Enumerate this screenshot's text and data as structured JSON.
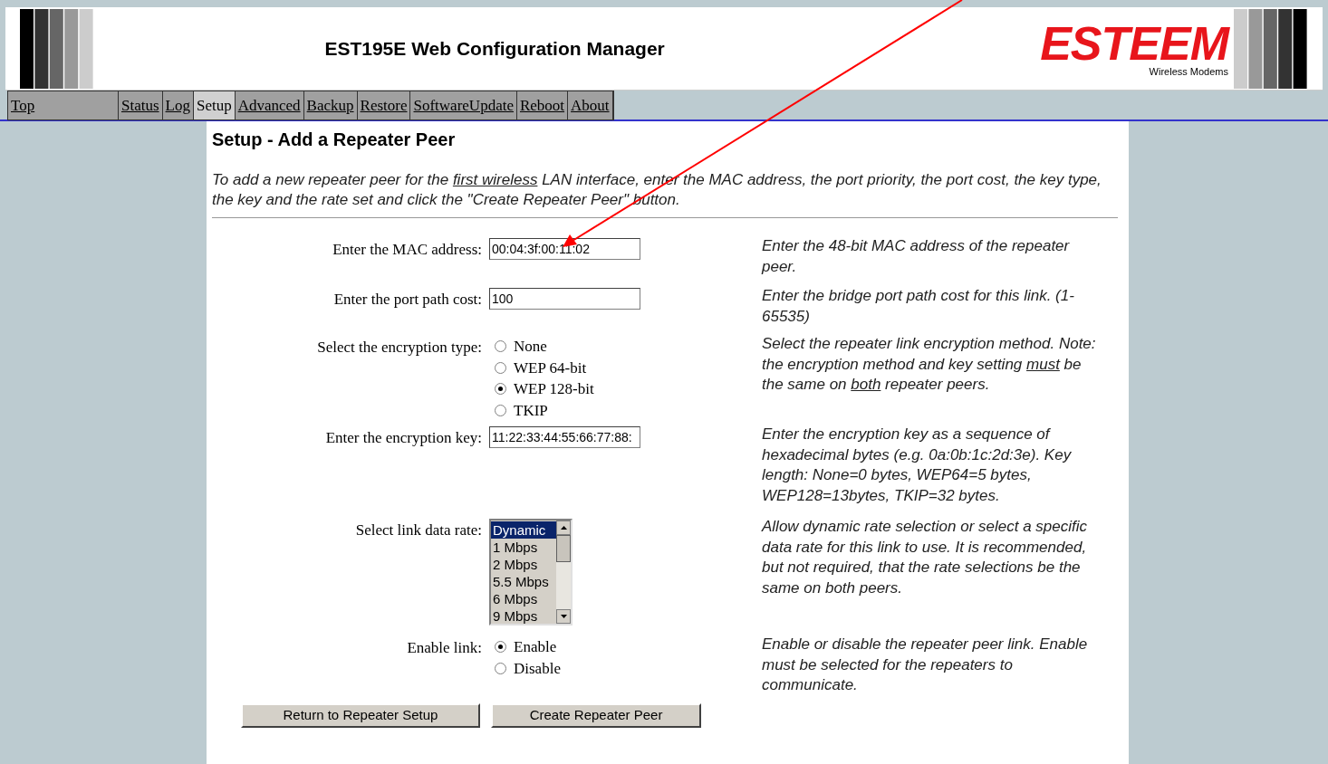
{
  "header": {
    "title": "EST195E Web Configuration Manager",
    "logo": "ESTEEM",
    "logo_tagline": "Wireless Modems"
  },
  "nav": [
    {
      "label": "Top",
      "selected": false
    },
    {
      "label": "Status",
      "selected": false
    },
    {
      "label": "Log",
      "selected": false
    },
    {
      "label": "Setup",
      "selected": true
    },
    {
      "label": "Advanced",
      "selected": false
    },
    {
      "label": "Backup",
      "selected": false
    },
    {
      "label": "Restore",
      "selected": false
    },
    {
      "label": "SoftwareUpdate",
      "selected": false
    },
    {
      "label": "Reboot",
      "selected": false
    },
    {
      "label": "About",
      "selected": false
    }
  ],
  "page_title": "Setup - Add a Repeater Peer",
  "intro": [
    {
      "text": "To add a new repeater peer for the ",
      "underline": false
    },
    {
      "text": "first wireless",
      "underline": true
    },
    {
      "text": " LAN interface, enter the MAC address, the port priority, the port cost, the key type, the key and the rate set and click the \"Create Repeater Peer\" button.",
      "underline": false
    }
  ],
  "fields": [
    {
      "kind": "text",
      "label": "Enter the MAC address:",
      "value": "00:04:3f:00:11:02",
      "help": [
        {
          "text": "Enter the 48-bit MAC address of the repeater peer.",
          "underline": false
        }
      ]
    },
    {
      "kind": "text",
      "label": "Enter the port path cost:",
      "value": "100",
      "help": [
        {
          "text": "Enter the bridge port path cost for this link. (1-65535)",
          "underline": false
        }
      ]
    },
    {
      "kind": "radio",
      "label": "Select the encryption type:",
      "options": [
        {
          "label": "None",
          "selected": false
        },
        {
          "label": "WEP 64-bit",
          "selected": false
        },
        {
          "label": "WEP 128-bit",
          "selected": true
        },
        {
          "label": "TKIP",
          "selected": false
        }
      ],
      "help": [
        {
          "text": "Select the repeater link encryption method. Note: the encryption method and key setting ",
          "underline": false
        },
        {
          "text": "must",
          "underline": true
        },
        {
          "text": " be the same on ",
          "underline": false
        },
        {
          "text": "both",
          "underline": true
        },
        {
          "text": " repeater peers.",
          "underline": false
        }
      ]
    },
    {
      "kind": "text",
      "label": "Enter the encryption key:",
      "value": "11:22:33:44:55:66:77:88:",
      "help": [
        {
          "text": "Enter the encryption key as a sequence of hexadecimal bytes (e.g. 0a:0b:1c:2d:3e). Key length: None=0 bytes, WEP64=5 bytes, WEP128=13bytes, TKIP=32 bytes.",
          "underline": false
        }
      ]
    },
    {
      "kind": "listbox",
      "label": "Select link data rate:",
      "options": [
        {
          "label": "Dynamic",
          "selected": true
        },
        {
          "label": "1 Mbps",
          "selected": false
        },
        {
          "label": "2 Mbps",
          "selected": false
        },
        {
          "label": "5.5 Mbps",
          "selected": false
        },
        {
          "label": "6 Mbps",
          "selected": false
        },
        {
          "label": "9 Mbps",
          "selected": false
        }
      ],
      "help": [
        {
          "text": "Allow dynamic rate selection or select a specific data rate for this link to use. It is recommended, but not required, that the rate selections be the same on both peers.",
          "underline": false
        }
      ]
    },
    {
      "kind": "radio",
      "label": "Enable link:",
      "options": [
        {
          "label": "Enable",
          "selected": true
        },
        {
          "label": "Disable",
          "selected": false
        }
      ],
      "help": [
        {
          "text": "Enable or disable the repeater peer link. Enable must be selected for the repeaters to communicate.",
          "underline": false
        }
      ]
    }
  ],
  "buttons": [
    "Return to Repeater Setup",
    "Create Repeater Peer"
  ]
}
